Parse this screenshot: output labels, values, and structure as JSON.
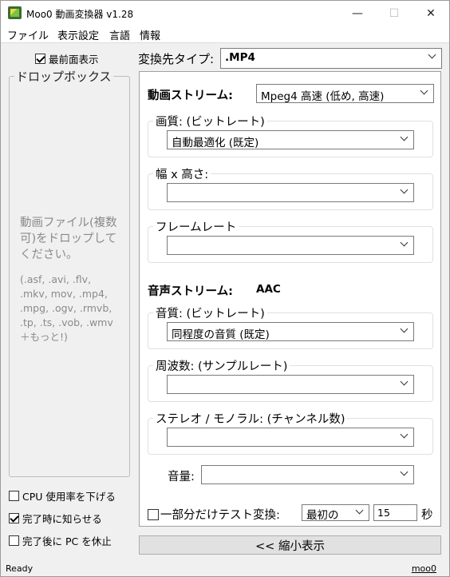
{
  "window": {
    "title": "Moo0 動画変換器 v1.28",
    "minimize": "—",
    "maximize": "☐",
    "close": "✕"
  },
  "menu": [
    "ファイル",
    "表示設定",
    "言語",
    "情報"
  ],
  "left": {
    "always_on_top": "最前面表示",
    "always_on_top_checked": true,
    "drop_box_title": "ドロップボックス",
    "drop_message": "動画ファイル(複数可)をドロップしてください。",
    "drop_formats": "(.asf, .avi, .flv, .mkv, mov, .mp4, .mpg, .ogv, .rmvb, .tp, .ts, .vob, .wmv ＋もっと!)",
    "options": [
      {
        "label": "CPU 使用率を下げる",
        "checked": false
      },
      {
        "label": "完了時に知らせる",
        "checked": true
      },
      {
        "label": "完了後に PC を休止",
        "checked": false
      }
    ]
  },
  "target": {
    "label": "変換先タイプ:",
    "value": ".MP4"
  },
  "video": {
    "label": "動画ストリーム:",
    "codec": "Mpeg4  高速      (低め,  高速)",
    "quality_label": "画質:  (ビットレート)",
    "quality_value": "自動最適化  (既定)",
    "size_label": "幅 x 高さ:",
    "size_value": "",
    "framerate_label": "フレームレート",
    "framerate_value": ""
  },
  "audio": {
    "label": "音声ストリーム:",
    "codec": "AAC",
    "quality_label": "音質:  (ビットレート)",
    "quality_value": "同程度の音質  (既定)",
    "freq_label": "周波数:  (サンプルレート)",
    "freq_value": "",
    "channel_label": "ステレオ / モノラル:  (チャンネル数)",
    "channel_value": "",
    "volume_label": "音量:",
    "volume_value": ""
  },
  "test": {
    "label": "一部分だけテスト変換:",
    "checked": false,
    "position": "最初の",
    "seconds": "15",
    "unit": "秒"
  },
  "shrink_button": "<< 縮小表示",
  "status": {
    "text": "Ready",
    "link": "moo0"
  }
}
